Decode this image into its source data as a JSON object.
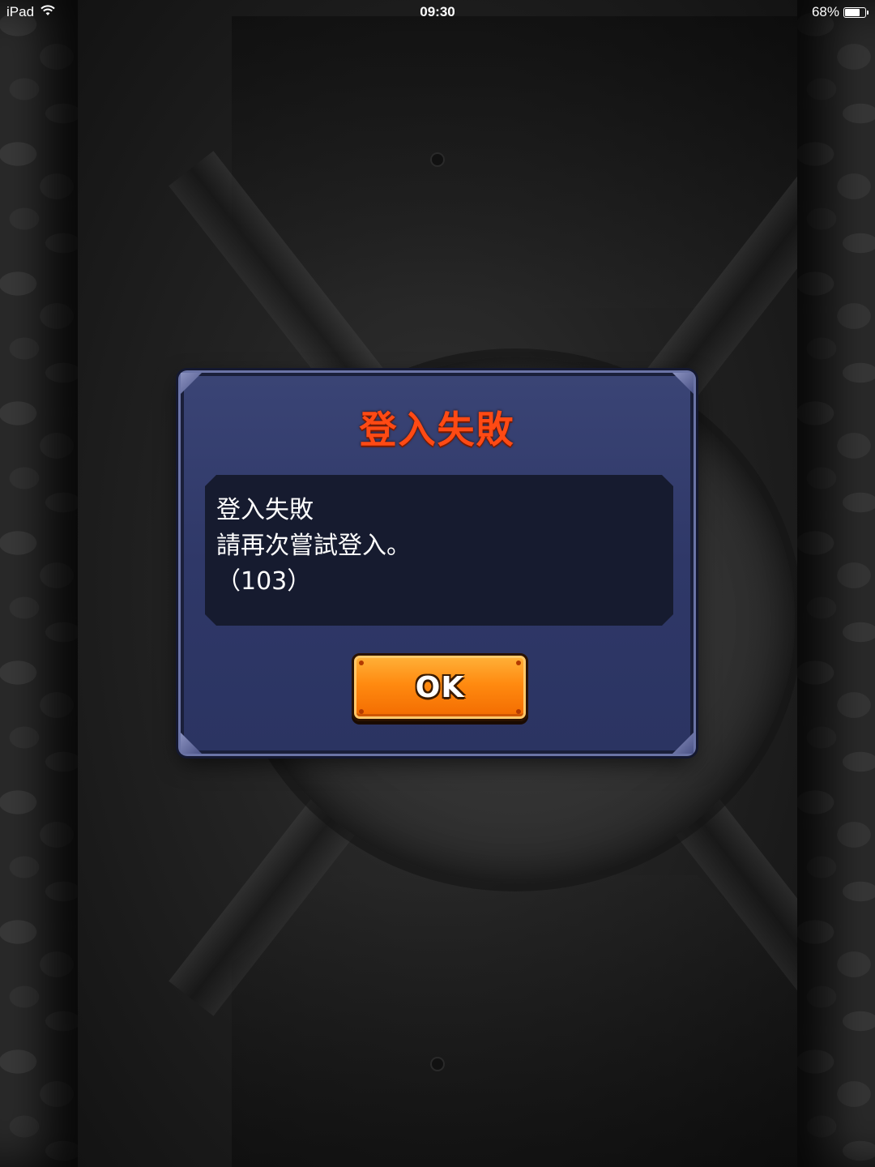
{
  "status_bar": {
    "device": "iPad",
    "wifi_icon": "wifi-icon",
    "time": "09:30",
    "battery_percent": "68%",
    "battery_level": 0.68
  },
  "dialog": {
    "title": "登入失敗",
    "message_lines": [
      "登入失敗",
      "請再次嘗試登入。",
      "（103）"
    ],
    "ok_label": "OK"
  },
  "colors": {
    "title": "#ff4a14",
    "dialog_bg": "#2f3868",
    "message_bg": "#161b2f",
    "button_orange": "#ff8a10"
  }
}
